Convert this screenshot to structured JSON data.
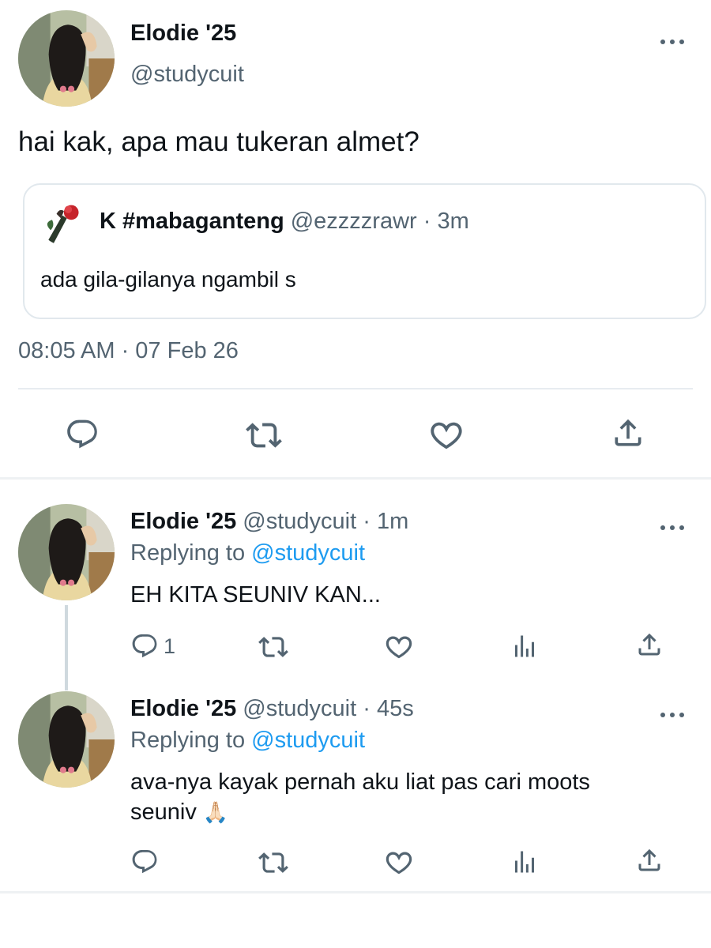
{
  "colors": {
    "text": "#0f1419",
    "secondary": "#536471",
    "link": "#1d9bf0",
    "border": "#e1e8ed",
    "icon": "#536471"
  },
  "main_tweet": {
    "author_name": "Elodie '25",
    "author_handle": "@studycuit",
    "text": "hai kak, apa mau tukeran almet?",
    "timestamp": "08:05 AM · 07 Feb 26",
    "avatar_icon": "avatar-portrait",
    "quote": {
      "author_name": "K #mabaganteng",
      "meta": "@ezzzzrawr · 3m",
      "text": "ada gila-gilanya ngambil s",
      "avatar_icon": "rose-avatar"
    },
    "actions": [
      "reply-icon",
      "retweet-icon",
      "like-icon",
      "share-icon"
    ]
  },
  "replies": [
    {
      "author_name": "Elodie '25",
      "meta": "@studycuit · 1m",
      "replying_label": "Replying to",
      "replying_to": "@studycuit",
      "text": "EH KITA SEUNIV KAN...",
      "emoji": "",
      "reply_count": "1",
      "actions": [
        "reply-icon",
        "retweet-icon",
        "like-icon",
        "analytics-icon",
        "share-icon"
      ]
    },
    {
      "author_name": "Elodie '25",
      "meta": "@studycuit · 45s",
      "replying_label": "Replying to",
      "replying_to": "@studycuit",
      "text": "ava-nya kayak pernah aku liat pas cari moots seuniv",
      "emoji": "🙏🏻",
      "reply_count": "",
      "actions": [
        "reply-icon",
        "retweet-icon",
        "like-icon",
        "analytics-icon",
        "share-icon"
      ]
    }
  ]
}
